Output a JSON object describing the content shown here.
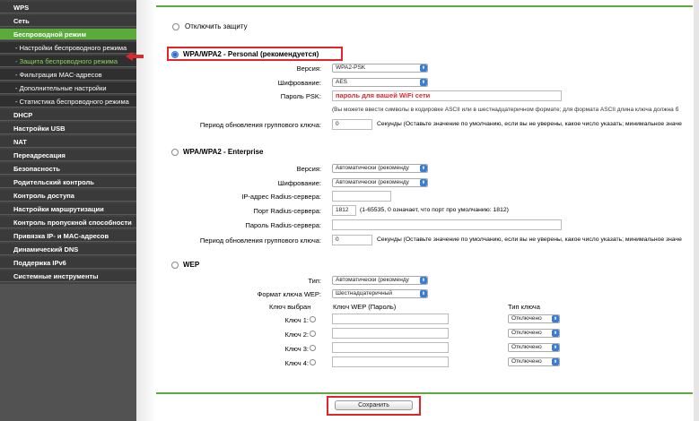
{
  "sidebar": {
    "items": [
      {
        "label": "WPS"
      },
      {
        "label": "Сеть"
      },
      {
        "label": "Беспроводной режим"
      },
      {
        "label": "- Настройки беспроводного режима"
      },
      {
        "label": "- Защита беспроводного режима"
      },
      {
        "label": "- Фильтрация MAC-адресов"
      },
      {
        "label": "- Дополнительные настройки"
      },
      {
        "label": "- Статистика беспроводного режима"
      },
      {
        "label": "DHCP"
      },
      {
        "label": "Настройки USB"
      },
      {
        "label": "NAT"
      },
      {
        "label": "Переадресация"
      },
      {
        "label": "Безопасность"
      },
      {
        "label": "Родительский контроль"
      },
      {
        "label": "Контроль доступа"
      },
      {
        "label": "Настройки маршрутизации"
      },
      {
        "label": "Контроль пропускной способности"
      },
      {
        "label": "Привязка IP- и MAC-адресов"
      },
      {
        "label": "Динамический DNS"
      },
      {
        "label": "Поддержка IPv6"
      },
      {
        "label": "Системные инструменты"
      }
    ]
  },
  "disable": {
    "label": "Отключить защиту"
  },
  "personal": {
    "title": "WPA/WPA2 - Personal (рекомендуется)",
    "version_label": "Версия:",
    "version_value": "WPA2-PSK",
    "encryption_label": "Шифрование:",
    "encryption_value": "AES",
    "psk_label": "Пароль PSK:",
    "psk_value": "пароль для вашей WiFi сети",
    "psk_hint": "(Вы можете ввести символы в кодировке ASCII или в шестнадцатеричном формате; для формата ASCII длина ключа должна б",
    "group_label": "Период обновления группового ключа:",
    "group_value": "0",
    "group_hint": "Секунды (Оставьте значение по умолчанию, если вы не уверены, какое число указать; минимальное значе"
  },
  "enterprise": {
    "title": "WPA/WPA2 - Enterprise",
    "version_label": "Версия:",
    "version_value": "Автоматически (рекоменду",
    "encryption_label": "Шифрование:",
    "encryption_value": "Автоматически (рекоменду",
    "ip_label": "IP-адрес Radius-сервера:",
    "ip_value": "",
    "port_label": "Порт Radius-сервера:",
    "port_value": "1812",
    "port_hint": "(1-65535, 0 означает, что порт про умолчанию: 1812)",
    "pwd_label": "Пароль Radius-сервера:",
    "pwd_value": "",
    "group_label": "Период обновления группового ключа:",
    "group_value": "0",
    "group_hint": "Секунды (Оставьте значение по умолчанию, если вы не уверены, какое число указать; минимальное значе"
  },
  "wep": {
    "title": "WEP",
    "type_label": "Тип:",
    "type_value": "Автоматически (рекоменду",
    "format_label": "Формат ключа WEP:",
    "format_value": "Шестнадцатеричный",
    "col_selected": "Ключ выбран",
    "col_key": "Ключ WEP (Пароль)",
    "col_type": "Тип ключа",
    "keys": [
      {
        "label": "Ключ 1:",
        "type": "Отключено"
      },
      {
        "label": "Ключ 2:",
        "type": "Отключено"
      },
      {
        "label": "Ключ 3:",
        "type": "Отключено"
      },
      {
        "label": "Ключ 4:",
        "type": "Отключено"
      }
    ]
  },
  "save_label": "Сохранить",
  "colors": {
    "accent": "#5aab3a",
    "highlight": "#e0262b",
    "sidebar": "#424242"
  }
}
